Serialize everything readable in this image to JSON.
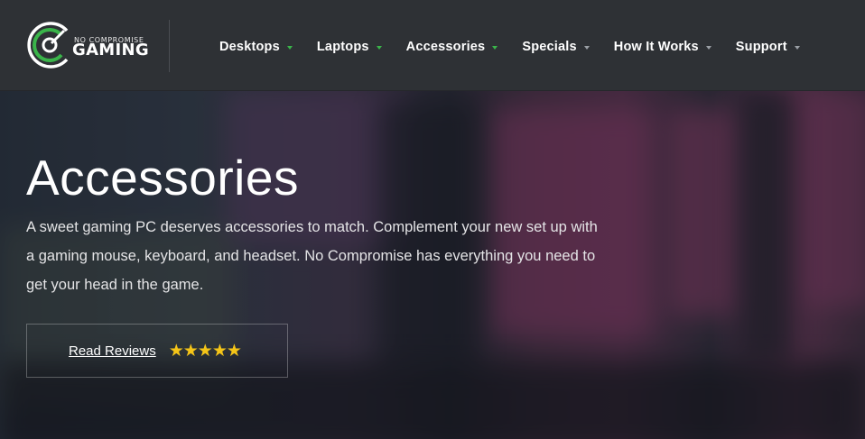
{
  "brand": {
    "tagline": "NO COMPROMISE",
    "name": "GAMING",
    "accent_color": "#3ab54a",
    "logo_icon": "target-c-logo-icon"
  },
  "nav": {
    "items": [
      {
        "label": "Desktops",
        "caret_color": "#3ab54a"
      },
      {
        "label": "Laptops",
        "caret_color": "#3ab54a"
      },
      {
        "label": "Accessories",
        "caret_color": "#3ab54a"
      },
      {
        "label": "Specials",
        "caret_color": "#9ba0a6"
      },
      {
        "label": "How It Works",
        "caret_color": "#9ba0a6"
      },
      {
        "label": "Support",
        "caret_color": "#9ba0a6"
      }
    ]
  },
  "hero": {
    "title": "Accessories",
    "description": "A sweet gaming PC deserves accessories to match. Complement your new set up with a gaming mouse, keyboard, and headset. No Compromise has everything you need to get your head in the game.",
    "reviews_label": "Read Reviews",
    "rating": 5,
    "rating_max": 5,
    "stars": "★★★★★",
    "star_color": "#f5c518"
  }
}
